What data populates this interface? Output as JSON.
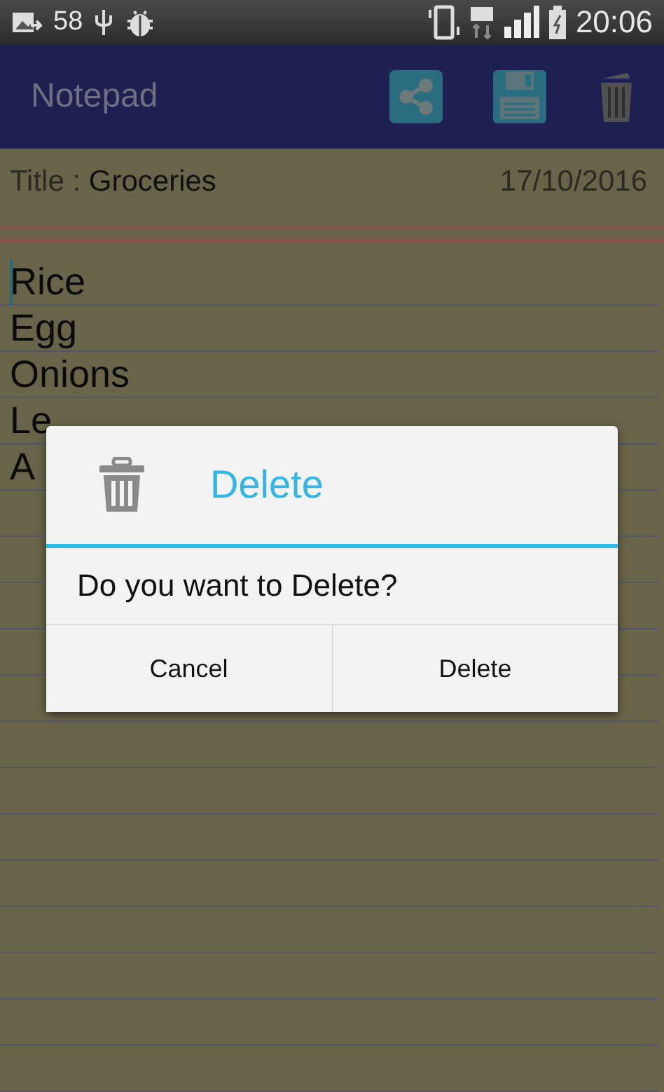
{
  "status_bar": {
    "notification_count": "58",
    "time": "20:06"
  },
  "app_bar": {
    "title": "Notepad"
  },
  "note": {
    "title_label": "Title :",
    "title": "Groceries",
    "date": "17/10/2016",
    "lines": [
      "Rice",
      "Egg",
      "Onions",
      "Le",
      "A"
    ]
  },
  "dialog": {
    "title": "Delete",
    "message": "Do you want to Delete?",
    "buttons": [
      "Cancel",
      "Delete"
    ]
  }
}
